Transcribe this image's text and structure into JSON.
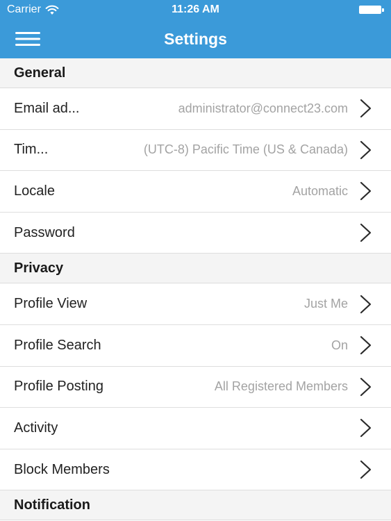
{
  "status_bar": {
    "carrier": "Carrier",
    "time": "11:26 AM"
  },
  "nav": {
    "title": "Settings"
  },
  "sections": {
    "general": {
      "title": "General",
      "rows": [
        {
          "label": "Email ad...",
          "value": "administrator@connect23.com"
        },
        {
          "label": "Tim...",
          "value": "(UTC-8) Pacific Time (US & Canada)"
        },
        {
          "label": "Locale",
          "value": "Automatic"
        },
        {
          "label": "Password",
          "value": ""
        }
      ]
    },
    "privacy": {
      "title": "Privacy",
      "rows": [
        {
          "label": "Profile View",
          "value": "Just Me"
        },
        {
          "label": "Profile Search",
          "value": "On"
        },
        {
          "label": "Profile Posting",
          "value": "All Registered Members"
        },
        {
          "label": "Activity",
          "value": ""
        },
        {
          "label": "Block Members",
          "value": ""
        }
      ]
    },
    "notification": {
      "title": "Notification"
    }
  },
  "colors": {
    "accent": "#3b9ad9",
    "section_bg": "#f4f4f4",
    "value_text": "#a3a3a3"
  },
  "icons": {
    "wifi": "wifi-icon",
    "battery": "battery-icon",
    "menu": "hamburger-menu-icon",
    "chevron": "chevron-right-icon"
  }
}
